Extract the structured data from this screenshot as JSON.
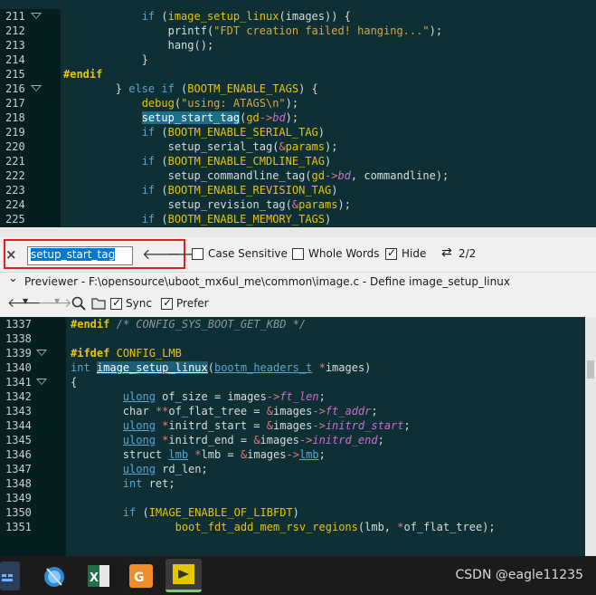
{
  "top_pane": {
    "lines": [
      {
        "n": "211",
        "fold": true,
        "html": "            <span class='c-kw'>if</span> (<span class='c-macro'>image_setup_linux</span>(images)) {"
      },
      {
        "n": "212",
        "fold": false,
        "html": "                printf(<span class='c-str'>\"FDT creation failed! hanging...\"</span>);"
      },
      {
        "n": "213",
        "fold": false,
        "html": "                hang();"
      },
      {
        "n": "214",
        "fold": false,
        "html": "            }"
      },
      {
        "n": "215",
        "fold": false,
        "html": "<span class='c-pp'>#endif</span>"
      },
      {
        "n": "216",
        "fold": true,
        "html": "        } <span class='c-kw'>else if</span> (<span class='c-macro'>BOOTM_ENABLE_TAGS</span>) {"
      },
      {
        "n": "217",
        "fold": false,
        "html": "            <span class='c-funcy'>debug</span>(<span class='c-str'>\"using: ATAGS\\n\"</span>);"
      },
      {
        "n": "218",
        "fold": false,
        "html": "            <span class='c-hl'>setup_start_tag</span>(<span class='c-funcy'>gd</span><span class='c-op'>-></span><span class='c-mem'>bd</span>);"
      },
      {
        "n": "219",
        "fold": false,
        "html": "            <span class='c-kw'>if</span> (<span class='c-macro'>BOOTM_ENABLE_SERIAL_TAG</span>)"
      },
      {
        "n": "220",
        "fold": false,
        "html": "                setup_serial_tag(<span class='c-op'>&amp;</span><span class='c-funcy'>params</span>);"
      },
      {
        "n": "221",
        "fold": false,
        "html": "            <span class='c-kw'>if</span> (<span class='c-macro'>BOOTM_ENABLE_CMDLINE_TAG</span>)"
      },
      {
        "n": "222",
        "fold": false,
        "html": "                setup_commandline_tag(<span class='c-funcy'>gd</span><span class='c-op'>-></span><span class='c-mem'>bd</span>, commandline);"
      },
      {
        "n": "223",
        "fold": false,
        "html": "            <span class='c-kw'>if</span> (<span class='c-macro'>BOOTM_ENABLE_REVISION_TAG</span>)"
      },
      {
        "n": "224",
        "fold": false,
        "html": "                setup_revision_tag(<span class='c-op'>&amp;</span><span class='c-funcy'>params</span>);"
      },
      {
        "n": "225",
        "fold": false,
        "html": "            <span class='c-kw'>if</span> (<span class='c-macro'>BOOTM_ENABLE_MEMORY_TAGS</span>)"
      }
    ]
  },
  "find_bar": {
    "close_icon": "×",
    "query": "setup_start_tag",
    "prev_arrow": "🡐",
    "next_arrow": "🡒",
    "case_sensitive_label": "Case Sensitive",
    "case_sensitive": false,
    "whole_words_label": "Whole Words",
    "whole_words": false,
    "hide_label": "Hide",
    "hide": true,
    "match_icon": "⇄",
    "match_count": "2/2"
  },
  "previewer": {
    "chevron": "⌄",
    "title": "Previewer - F:\\opensource\\uboot_mx6ul_me\\common\\image.c - Define image_setup_linux",
    "sync_label": "Sync",
    "sync": true,
    "prefer_label": "Prefer",
    "prefer": true
  },
  "bottom_pane": {
    "lines": [
      {
        "n": "1337",
        "fold": false,
        "html": "<span class='c-pp'>#endif</span> <span class='c-cmt'>/* CONFIG_SYS_BOOT_GET_KBD */</span>"
      },
      {
        "n": "1338",
        "fold": false,
        "html": ""
      },
      {
        "n": "1339",
        "fold": true,
        "html": "<span class='c-pp'>#ifdef</span> <span class='c-macro'>CONFIG_LMB</span>"
      },
      {
        "n": "1340",
        "fold": false,
        "html": "<span class='c-kw'>int</span> <span class='c-hl' style='background:#1d5f78;text-decoration:underline'>image_setup_linux</span>(<span class='c-type'>bootm_headers_t</span> <span class='c-op'>*</span>images)"
      },
      {
        "n": "1341",
        "fold": true,
        "html": "{"
      },
      {
        "n": "1342",
        "fold": false,
        "html": "        <span class='c-type'>ulong</span> of_size = images<span class='c-op'>-></span><span class='c-mem'>ft_len</span>;"
      },
      {
        "n": "1343",
        "fold": false,
        "html": "        char <span class='c-op'>**</span>of_flat_tree = <span class='c-op'>&amp;</span>images<span class='c-op'>-></span><span class='c-mem'>ft_addr</span>;"
      },
      {
        "n": "1344",
        "fold": false,
        "html": "        <span class='c-type'>ulong</span> <span class='c-op'>*</span>initrd_start = <span class='c-op'>&amp;</span>images<span class='c-op'>-></span><span class='c-mem'>initrd_start</span>;"
      },
      {
        "n": "1345",
        "fold": false,
        "html": "        <span class='c-type'>ulong</span> <span class='c-op'>*</span>initrd_end = <span class='c-op'>&amp;</span>images<span class='c-op'>-></span><span class='c-mem'>initrd_end</span>;"
      },
      {
        "n": "1346",
        "fold": false,
        "html": "        struct <span class='c-type'>lmb</span> <span class='c-op'>*</span>lmb = <span class='c-op'>&amp;</span>images<span class='c-op'>-></span><span class='c-type'>lmb</span>;"
      },
      {
        "n": "1347",
        "fold": false,
        "html": "        <span class='c-type'>ulong</span> rd_len;"
      },
      {
        "n": "1348",
        "fold": false,
        "html": "        <span class='c-kw'>int</span> ret;"
      },
      {
        "n": "1349",
        "fold": false,
        "html": ""
      },
      {
        "n": "1350",
        "fold": false,
        "html": "        <span class='c-kw'>if</span> (<span class='c-macro'>IMAGE_ENABLE_OF_LIBFDT</span>)"
      },
      {
        "n": "1351",
        "fold": false,
        "html": "                <span class='c-funcy'>boot_fdt_add_mem_rsv_regions</span>(lmb, <span class='c-op'>*</span>of_flat_tree);"
      }
    ]
  },
  "taskbar": {
    "watermark": "CSDN @eagle11235",
    "icons": [
      "start-icon",
      "browser-icon",
      "excel-icon",
      "pdf-icon",
      "source-insight-icon"
    ]
  },
  "colors": {
    "editor_bg": "#0e2f33",
    "gutter_bg": "#071e21",
    "find_outline": "#e02020",
    "highlight": "#1d6f89"
  }
}
